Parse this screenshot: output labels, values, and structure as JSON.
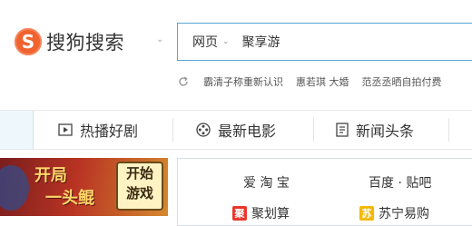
{
  "brand": {
    "logo_letter": "S",
    "name": "搜狗搜索",
    "caret": "⌄"
  },
  "search": {
    "scope": "网页",
    "scope_chevron": "⌄",
    "query": "聚享游"
  },
  "hotwords": {
    "refresh_icon": "refresh-icon",
    "items": [
      "霸清子称重新认识",
      "惠若琪 大婚",
      "范丞丞晒自拍付费"
    ]
  },
  "nav": {
    "items": [
      {
        "label": "热播好剧",
        "icon": "play-square-icon"
      },
      {
        "label": "最新电影",
        "icon": "film-reel-icon"
      },
      {
        "label": "新闻头条",
        "icon": "document-icon"
      }
    ]
  },
  "banner": {
    "line1": "开局",
    "line2": "一头鲲",
    "badge_line1": "开始",
    "badge_line2": "游戏"
  },
  "links": {
    "row1": [
      "爱 淘 宝",
      "百度 · 贴吧"
    ],
    "row2": [
      {
        "label": "聚划算",
        "icon_letter": "聚",
        "color": "#e8372b"
      },
      {
        "label": "苏宁易购",
        "icon_letter": "苏",
        "color": "#f5b800"
      }
    ]
  },
  "colors": {
    "logo_orange": "#f0622e",
    "search_border": "#59a7d8"
  }
}
